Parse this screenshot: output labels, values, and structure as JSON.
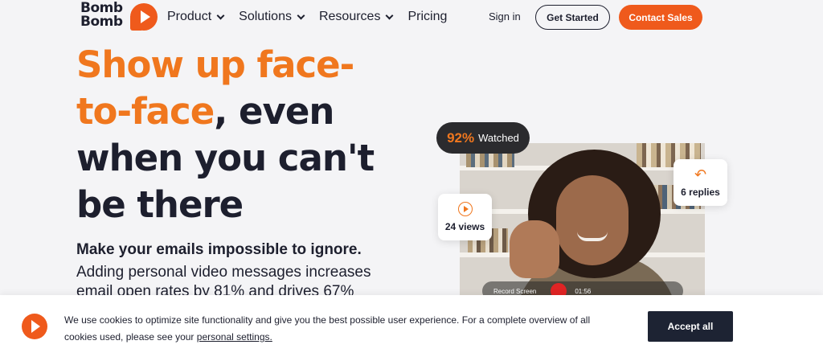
{
  "header": {
    "logo_line1": "Bomb",
    "logo_line2": "Bomb",
    "nav": [
      {
        "label": "Product"
      },
      {
        "label": "Solutions"
      },
      {
        "label": "Resources"
      },
      {
        "label": "Pricing"
      }
    ],
    "sign_in": "Sign in",
    "get_started": "Get Started",
    "contact_sales": "Contact Sales"
  },
  "hero": {
    "headline_orange_1": "Show up face-",
    "headline_orange_2": "to-face",
    "headline_dark_2": ", even",
    "headline_3": "when you can't",
    "headline_4": "be there",
    "subhead": "Make your emails impossible to ignore.",
    "body": "Adding personal video messages increases email open rates by 81% and drives 67%"
  },
  "video_card": {
    "watched_pct": "92%",
    "watched_label": "Watched",
    "views_label": "24 views",
    "replies_label": "6 replies",
    "record_label": "Record Screen",
    "timer": "01:56"
  },
  "cookie_banner": {
    "text_part1": "We use cookies to optimize site functionality and give you the best possible user experience. For a complete overview of all cookies used, please see your ",
    "link": "personal settings.",
    "accept": "Accept all"
  },
  "colors": {
    "brand_orange": "#ef5a1c",
    "headline_orange": "#f0771e",
    "dark": "#1d1f2e",
    "accept_button": "#1d2333"
  }
}
